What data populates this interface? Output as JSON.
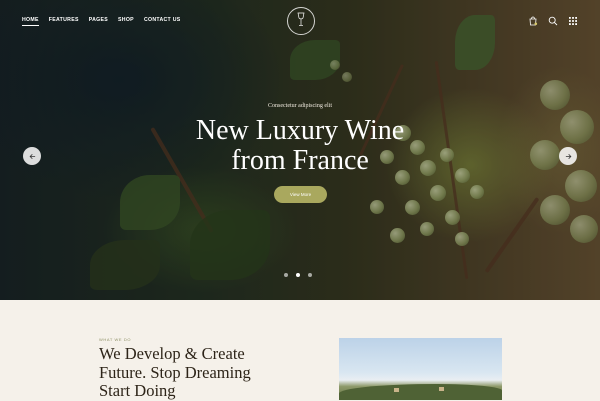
{
  "nav": {
    "items": [
      {
        "label": "HOME",
        "active": true
      },
      {
        "label": "FEATURES",
        "active": false
      },
      {
        "label": "PAGES",
        "active": false
      },
      {
        "label": "SHOP",
        "active": false
      },
      {
        "label": "CONTACT US",
        "active": false
      }
    ]
  },
  "header": {
    "icons": [
      "cart-icon",
      "search-icon",
      "grid-menu-icon"
    ]
  },
  "hero": {
    "eyebrow": "Consectetur adipiscing elit",
    "title_line1": "New Luxury Wine",
    "title_line2": "from France",
    "cta_label": "View More",
    "slide_count": 3,
    "active_slide": 2
  },
  "section": {
    "label": "WHAT WE DO",
    "headline_line1": "We Develop & Create",
    "headline_line2": "Future. Stop Dreaming",
    "headline_line3": "Start Doing"
  },
  "colors": {
    "accent": "#a9a85e",
    "background": "#f5f1ea",
    "heading": "#2d2418"
  }
}
